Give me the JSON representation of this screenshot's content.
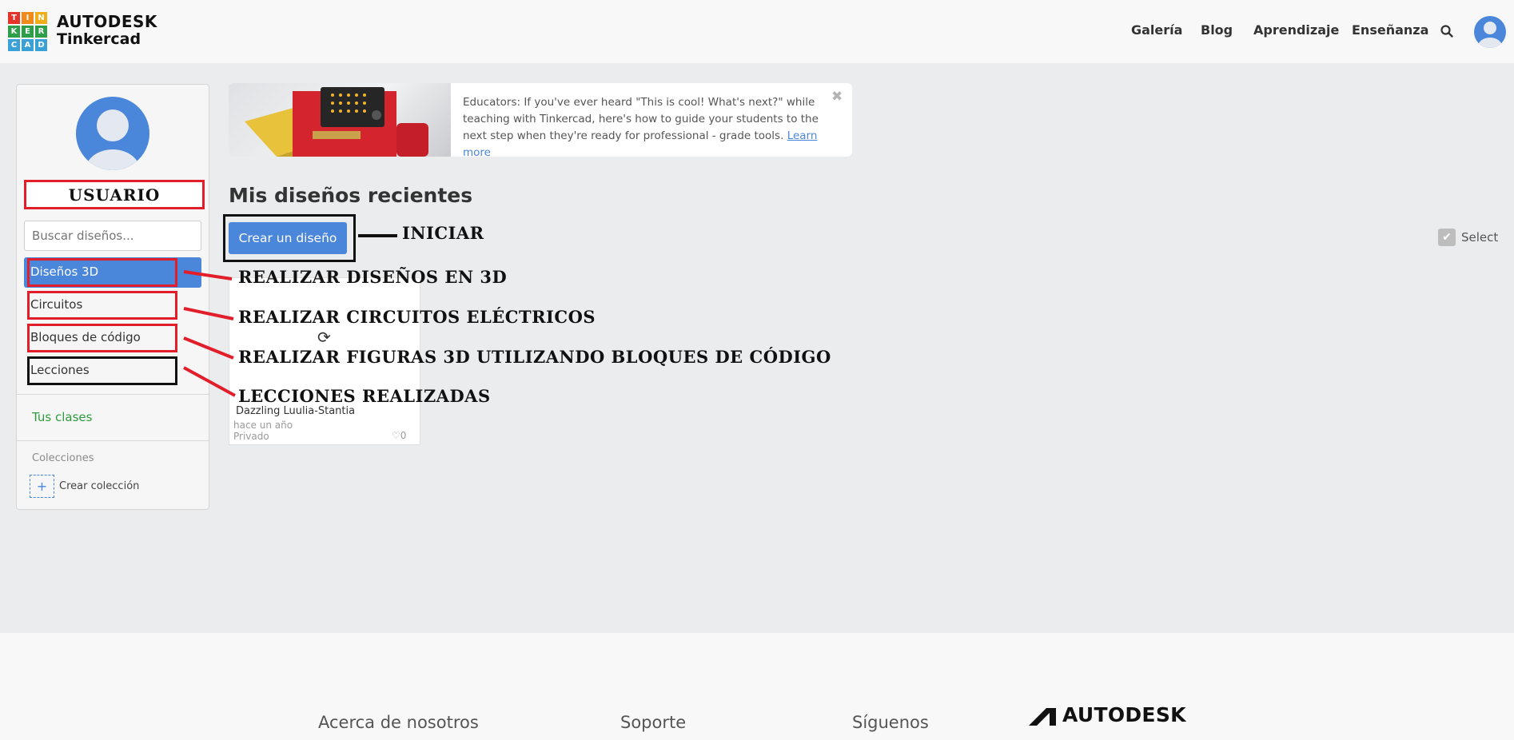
{
  "header": {
    "logo_letters": [
      "T",
      "I",
      "N",
      "K",
      "E",
      "R",
      "C",
      "A",
      "D"
    ],
    "logo_colors": [
      "#e5332a",
      "#f08a1b",
      "#f0ae1b",
      "#2c9f48",
      "#2c9f48",
      "#2c9f48",
      "#3aa1d8",
      "#3aa1d8",
      "#3aa1d8"
    ],
    "brand_top": "AUTODESK",
    "brand_bottom": "Tinkercad",
    "nav": [
      "Galería",
      "Blog",
      "Aprendizaje",
      "Enseñanza"
    ]
  },
  "sidebar": {
    "username": "USUARIO",
    "search_placeholder": "Buscar diseños...",
    "items": [
      {
        "label": "Diseños 3D"
      },
      {
        "label": "Circuitos"
      },
      {
        "label": "Bloques de código"
      },
      {
        "label": "Lecciones"
      }
    ],
    "classes": "Tus clases",
    "collections_heading": "Colecciones",
    "create_collection": "Crear colección"
  },
  "banner": {
    "text": "Educators: If you've ever heard \"This is cool! What's next?\" while teaching with Tinkercad, here's how to guide your students to the next step when they're ready for professional - grade tools.",
    "link": "Learn more"
  },
  "main": {
    "title": "Mis diseños recientes",
    "create_button": "Crear un diseño",
    "select_label": "Select"
  },
  "card": {
    "name": "Dazzling Luulia-Stantia",
    "time": "hace un año",
    "privacy": "Privado",
    "likes": "0"
  },
  "annotations": {
    "iniciar": "INICIAR",
    "disenos3d": "REALIZAR DISEÑOS EN 3D",
    "circuitos": "REALIZAR CIRCUITOS ELÉCTRICOS",
    "bloques": "REALIZAR FIGURAS 3D UTILIZANDO BLOQUES DE CÓDIGO",
    "lecciones": "LECCIONES REALIZADAS"
  },
  "footer": {
    "about": "Acerca de nosotros",
    "support": "Soporte",
    "follow": "Síguenos",
    "brand": "AUTODESK"
  },
  "colors": {
    "accent": "#4a86d9",
    "annotation_red": "#e11e2a",
    "annotation_black": "#111111",
    "classes_green": "#2e9b3f"
  }
}
